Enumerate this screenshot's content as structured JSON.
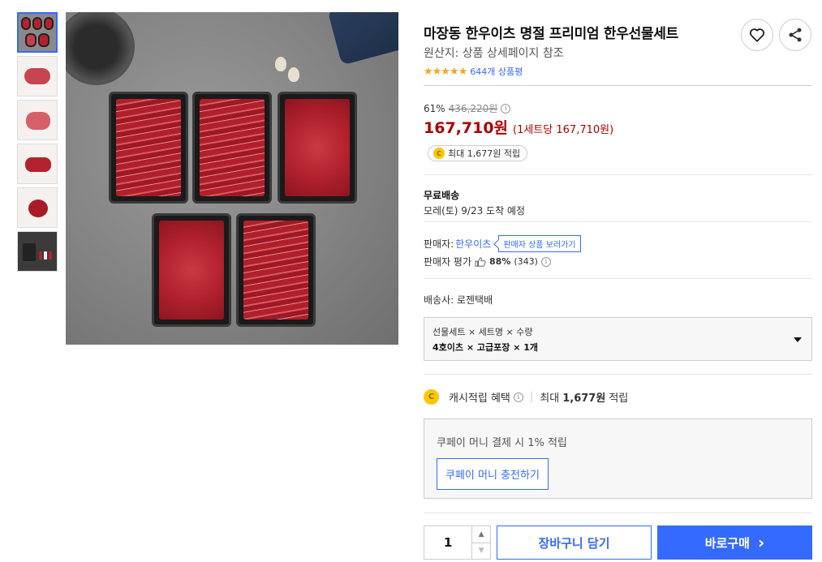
{
  "product": {
    "title": "마장동 한우이츠 명절 프리미엄 한우선물세트",
    "origin": "원산지: 상품 상세페이지 참조",
    "stars": "★★★★★",
    "review_count": "644개 상품평"
  },
  "price": {
    "discount_rate": "61%",
    "original_price": "436,220원",
    "sale_price": "167,710원",
    "unit_price": "(1세트당 167,710원)",
    "cash_badge": "최대 1,677원 적립",
    "coin_letter": "C",
    "info_glyph": "i"
  },
  "shipping": {
    "title": "무료배송",
    "arrival": "모레(토) 9/23 도착 예정",
    "courier": "배송사: 로젠택배"
  },
  "seller": {
    "label": "판매자:",
    "name": "한우이츠",
    "tooltip": "판매자 상품 보러가기",
    "rating_label": "판매자 평가",
    "rating_pct": "88%",
    "rating_count": "(343)"
  },
  "option": {
    "labels": "선물세트 × 세트명 × 수량",
    "values": "4호이츠 × 고급포장 × 1개"
  },
  "cash": {
    "label": "캐시적립 혜택",
    "divider": "|",
    "max_label": "최대",
    "amount": "1,677원",
    "suffix": "적립"
  },
  "coupay": {
    "text": "쿠페이 머니 결제 시 1% 적립",
    "button": "쿠페이 머니 충전하기"
  },
  "purchase": {
    "quantity": "1",
    "up_arrow": "▲",
    "down_arrow": "▼",
    "cart_button": "장바구니 담기",
    "buy_button": "바로구매",
    "buy_arrow": "›"
  },
  "colors": {
    "accent": "#346aff",
    "price": "#ae0000",
    "star": "#f5a623",
    "coin": "#fbc800"
  }
}
